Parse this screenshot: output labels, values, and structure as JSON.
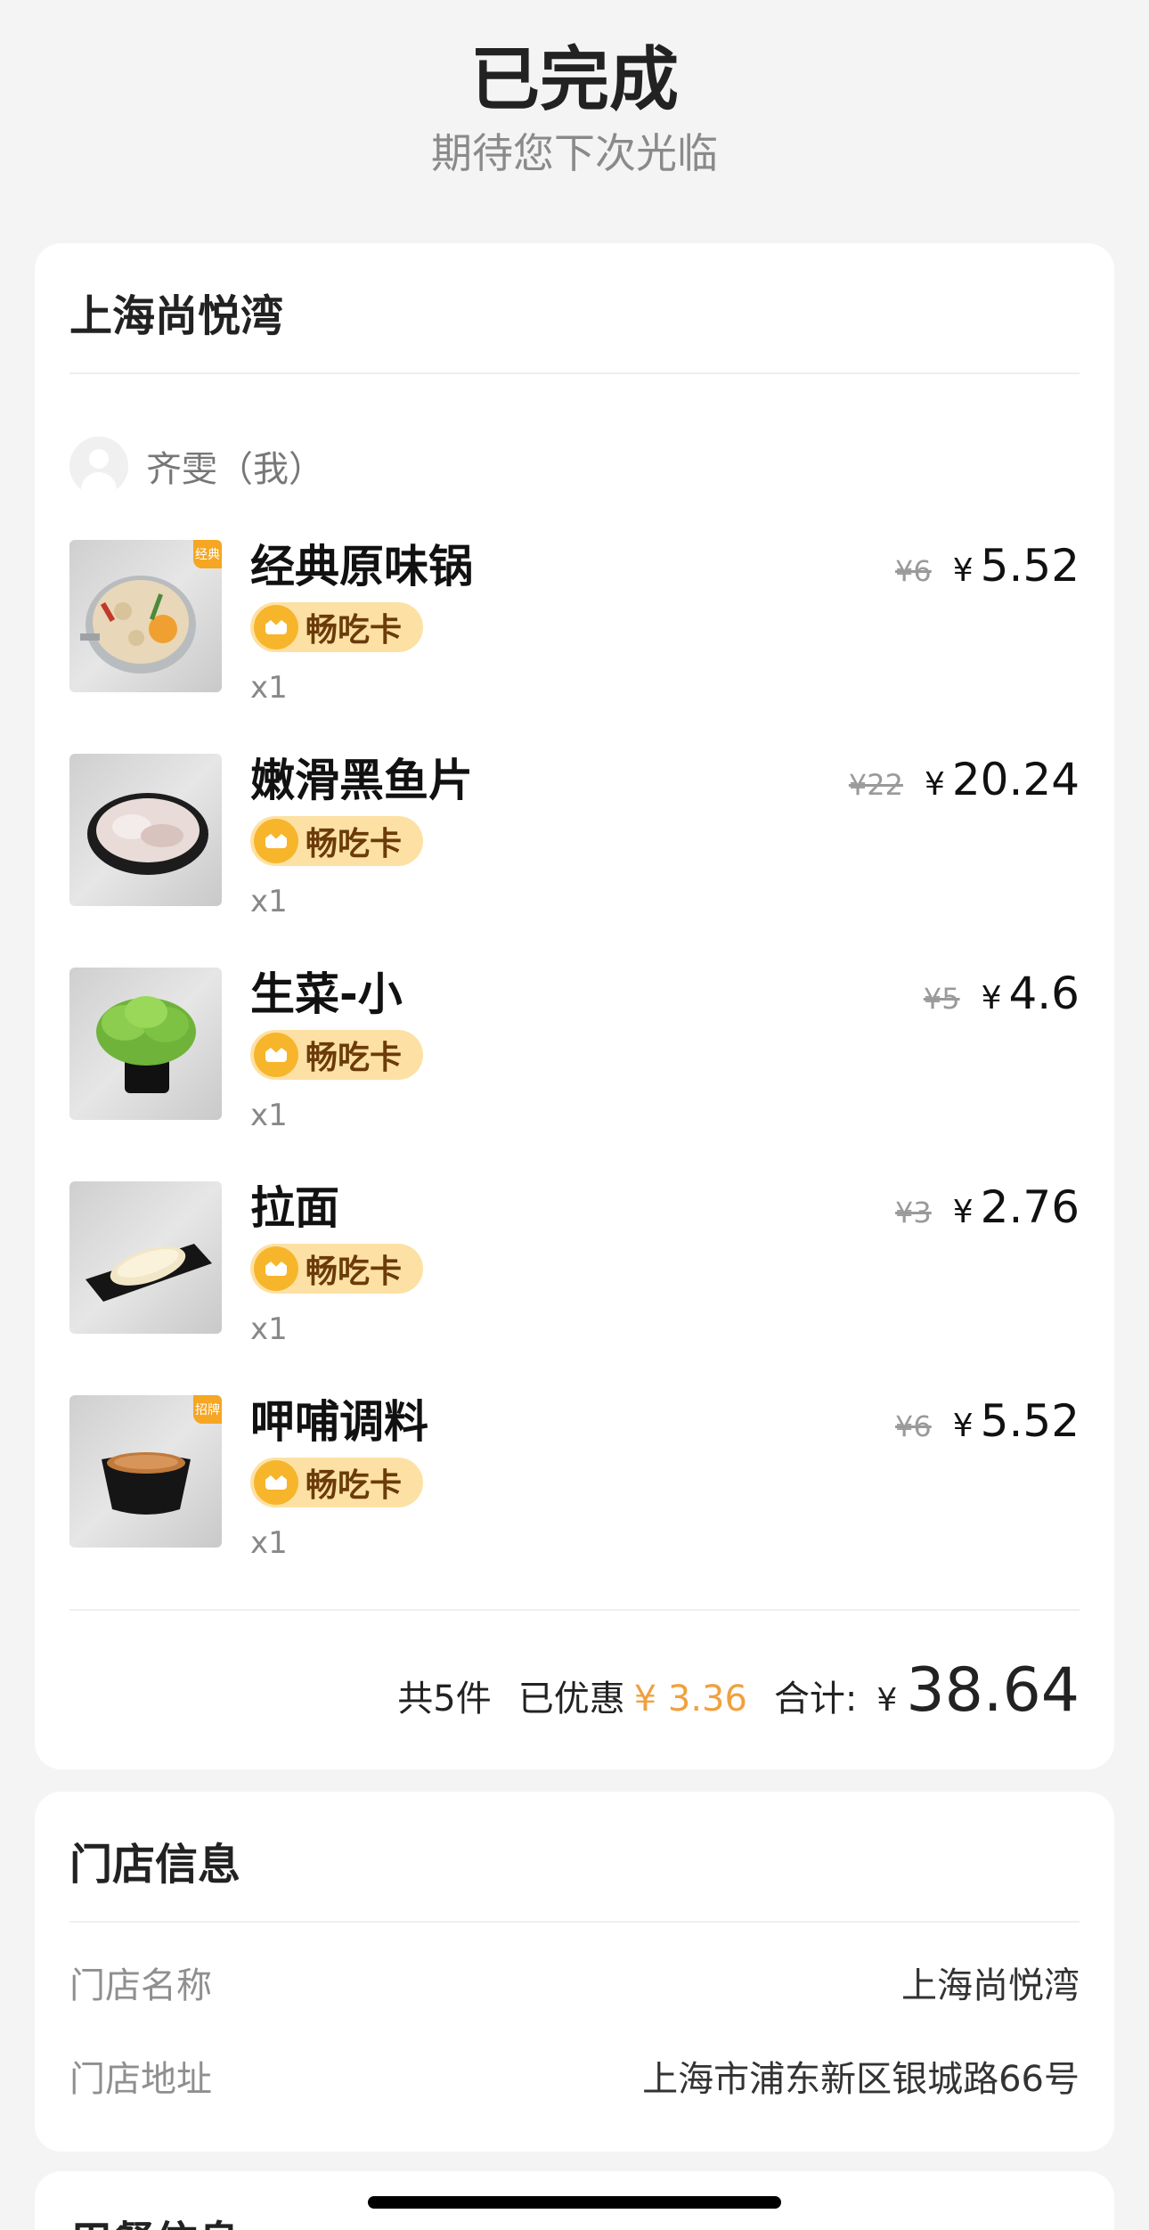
{
  "status": {
    "title": "已完成",
    "subtitle": "期待您下次光临"
  },
  "order": {
    "store_name": "上海尚悦湾",
    "diner": "齐雯（我）",
    "items": [
      {
        "name": "经典原味锅",
        "tag": "经典",
        "badge": "畅吃卡",
        "qty": "x1",
        "orig_price": "¥6",
        "yen": "¥",
        "price": "5.52"
      },
      {
        "name": "嫩滑黑鱼片",
        "tag": "",
        "badge": "畅吃卡",
        "qty": "x1",
        "orig_price": "¥22",
        "yen": "¥",
        "price": "20.24"
      },
      {
        "name": "生菜-小",
        "tag": "",
        "badge": "畅吃卡",
        "qty": "x1",
        "orig_price": "¥5",
        "yen": "¥",
        "price": "4.6"
      },
      {
        "name": "拉面",
        "tag": "",
        "badge": "畅吃卡",
        "qty": "x1",
        "orig_price": "¥3",
        "yen": "¥",
        "price": "2.76"
      },
      {
        "name": "呷哺调料",
        "tag": "招牌",
        "badge": "畅吃卡",
        "qty": "x1",
        "orig_price": "¥6",
        "yen": "¥",
        "price": "5.52"
      }
    ],
    "summary": {
      "count": "共5件",
      "discount_label": "已优惠",
      "discount": "¥ 3.36",
      "total_label": "合计:",
      "yen": "¥",
      "total": "38.64"
    }
  },
  "store_info": {
    "title": "门店信息",
    "name_label": "门店名称",
    "name_value": "上海尚悦湾",
    "address_label": "门店地址",
    "address_value": "上海市浦东新区银城路66号"
  },
  "dining_info": {
    "title": "用餐信息"
  },
  "colors": {
    "accent": "#f0a040",
    "badge_bg": "#fde1a4",
    "badge_icon": "#f7b52c",
    "badge_text": "#6b3b0a"
  }
}
